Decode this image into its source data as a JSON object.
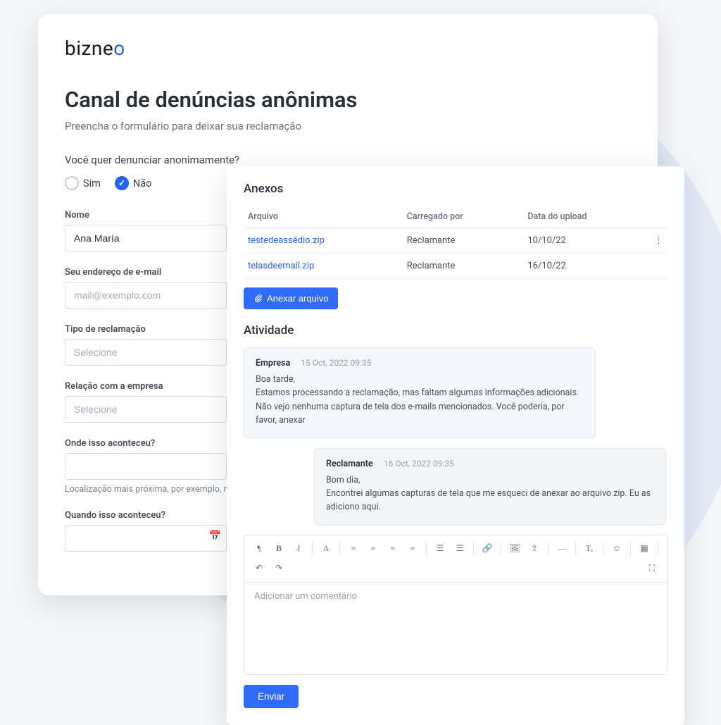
{
  "brand": "bizneo",
  "page": {
    "title": "Canal de denúncias anônimas",
    "subtitle": "Preencha o formulário para deixar sua reclamação"
  },
  "anon": {
    "question": "Você quer denunciar anonimamente?",
    "yes": "Sim",
    "no": "Não",
    "selected": "no"
  },
  "form": {
    "name_label": "Nome",
    "name_value": "Ana María",
    "email_label": "Seu endereço de e-mail",
    "email_placeholder": "mail@exemplo.com",
    "type_label": "Tipo de reclamação",
    "type_placeholder": "Selecione",
    "relation_label": "Relação com a empresa",
    "relation_placeholder": "Selecione",
    "where_label": "Onde isso aconteceu?",
    "where_helper": "Localização mais próxima, por exemplo, nome do edifício, número do andar, escritório",
    "when_label": "Quando isso aconteceu?"
  },
  "attachments": {
    "heading": "Anexos",
    "col_file": "Arquivo",
    "col_uploader": "Carregado por",
    "col_date": "Data do upload",
    "rows": [
      {
        "file": "testedeassédio.zip",
        "uploader": "Reclamante",
        "date": "10/10/22"
      },
      {
        "file": "telasdeemail.zip",
        "uploader": "Reclamante",
        "date": "16/10/22"
      }
    ],
    "attach_btn": "Anexar arquivo"
  },
  "activity": {
    "heading": "Atividade",
    "messages": [
      {
        "role": "company",
        "author": "Empresa",
        "time": "15 Oct, 2022  09:35",
        "body": "Boa tarde,\nEstamos processando a reclamação, mas faltam algumas informações adicionais. Não vejo nenhuma captura de tela dos e-mails mencionados. Você poderia, por favor, anexar"
      },
      {
        "role": "claimant",
        "author": "Reclamante",
        "time": "16 Oct, 2022  09:35",
        "body": "Bom dia,\nEncontrei algumas capturas de tela que me esqueci de anexar ao arquivo zip. Eu as adiciono aqui."
      }
    ],
    "editor_placeholder": "Adicionar um comentário",
    "send": "Enviar"
  }
}
